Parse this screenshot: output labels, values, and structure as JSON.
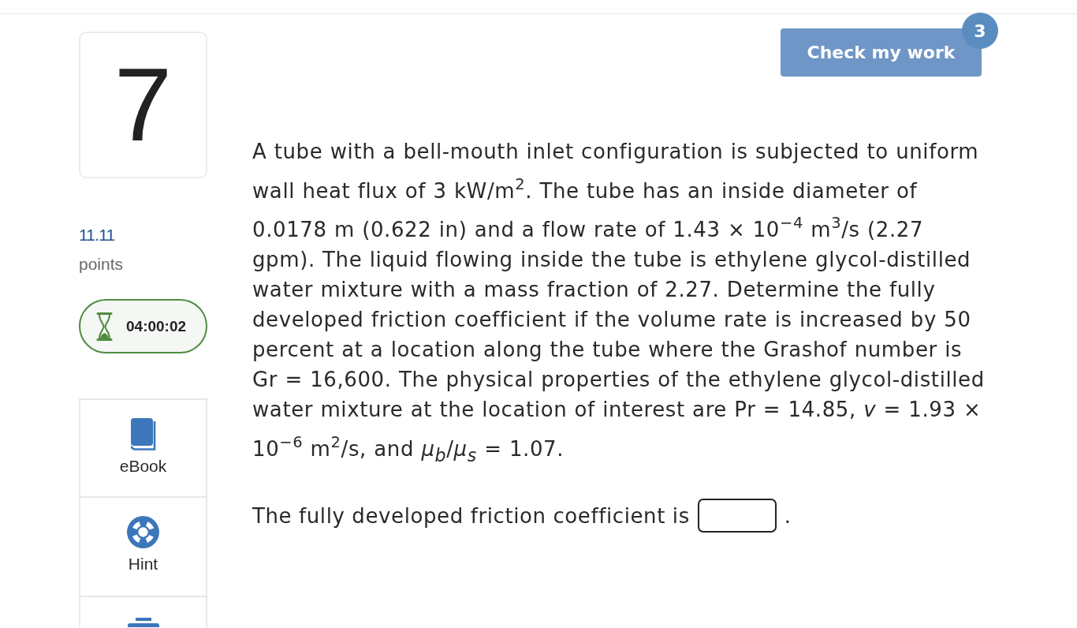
{
  "question": {
    "number": "7",
    "points": "11.11",
    "points_label": "points"
  },
  "timer": {
    "time": "04:00:02"
  },
  "tools": [
    {
      "kind": "ebook",
      "label": "eBook"
    },
    {
      "kind": "hint",
      "label": "Hint"
    },
    {
      "kind": "print"
    }
  ],
  "check_button": {
    "label": "Check my work",
    "disabled": true,
    "badge": "3"
  },
  "problem": {
    "text": "A tube with a bell-mouth inlet configuration is subjected to uniform wall heat flux of 3 kW/m$^{2}$. The tube has an inside diameter of 0.0178 m (0.622 in) and a flow rate of 1.43 × 10$^{−4}$ m$^{3}$/s (2.27 gpm). The liquid flowing inside the tube is ethylene glycol-distilled water mixture with a mass fraction of 2.27. Determine the fully developed friction coefficient if the volume rate is increased by 50 percent at a location along the tube where the Grashof number is Gr = 16,600. The physical properties of the ethylene glycol-distilled water mixture at the location of interest are Pr = 14.85, *v* = 1.93 × 10$^{−6}$ m$^{2}$/s, and *μ*$_{b}$/*μ*$_{s}$ = 1.07."
  },
  "answer": {
    "prompt": "The fully developed friction coefficient is",
    "suffix": "."
  }
}
